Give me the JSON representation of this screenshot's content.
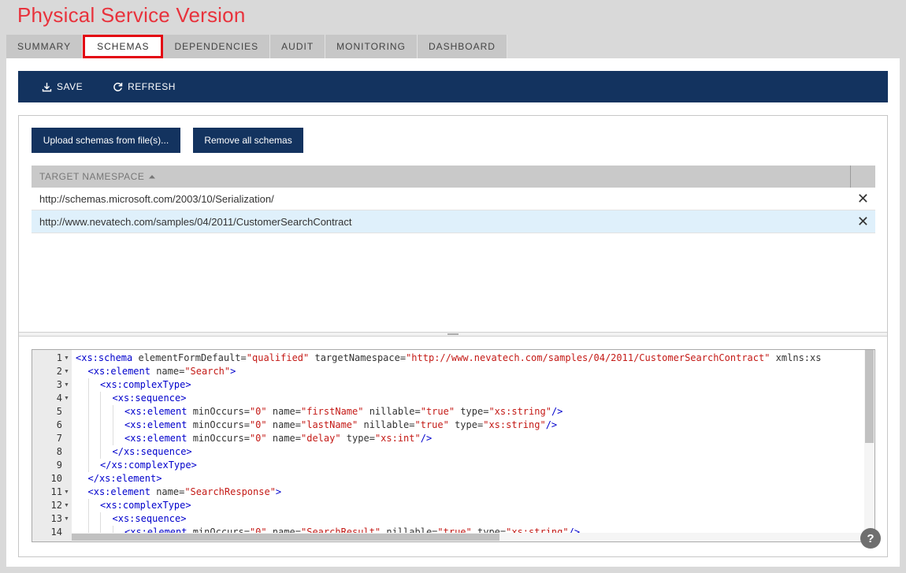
{
  "page": {
    "title": "Physical Service Version"
  },
  "tabs": [
    {
      "label": "SUMMARY",
      "active": false
    },
    {
      "label": "SCHEMAS",
      "active": true
    },
    {
      "label": "DEPENDENCIES",
      "active": false
    },
    {
      "label": "AUDIT",
      "active": false
    },
    {
      "label": "MONITORING",
      "active": false
    },
    {
      "label": "DASHBOARD",
      "active": false
    }
  ],
  "toolbar": {
    "save_label": "SAVE",
    "refresh_label": "REFRESH",
    "save_icon": "download-icon",
    "refresh_icon": "refresh-icon"
  },
  "actions": {
    "upload_label": "Upload schemas from file(s)...",
    "remove_label": "Remove all schemas"
  },
  "grid": {
    "column_header": "TARGET NAMESPACE",
    "sort": "ascending",
    "rows": [
      {
        "namespace": "http://schemas.microsoft.com/2003/10/Serialization/",
        "selected": false
      },
      {
        "namespace": "http://www.nevatech.com/samples/04/2011/CustomerSearchContract",
        "selected": true
      }
    ]
  },
  "editor": {
    "lines": [
      {
        "n": "1",
        "fold": true,
        "indent": 0,
        "parts": [
          [
            "tag",
            "<xs:schema "
          ],
          [
            "attr",
            "elementFormDefault="
          ],
          [
            "val",
            "\"qualified\""
          ],
          [
            "attr",
            " targetNamespace="
          ],
          [
            "val",
            "\"http://www.nevatech.com/samples/04/2011/CustomerSearchContract\""
          ],
          [
            "attr",
            " xmlns:xs"
          ]
        ]
      },
      {
        "n": "2",
        "fold": true,
        "indent": 1,
        "parts": [
          [
            "tag",
            "<xs:element "
          ],
          [
            "attr",
            "name="
          ],
          [
            "val",
            "\"Search\""
          ],
          [
            "tag",
            ">"
          ]
        ]
      },
      {
        "n": "3",
        "fold": true,
        "indent": 2,
        "parts": [
          [
            "tag",
            "<xs:complexType>"
          ]
        ]
      },
      {
        "n": "4",
        "fold": true,
        "indent": 3,
        "parts": [
          [
            "tag",
            "<xs:sequence>"
          ]
        ]
      },
      {
        "n": "5",
        "fold": false,
        "indent": 4,
        "parts": [
          [
            "tag",
            "<xs:element "
          ],
          [
            "attr",
            "minOccurs="
          ],
          [
            "val",
            "\"0\""
          ],
          [
            "attr",
            " name="
          ],
          [
            "val",
            "\"firstName\""
          ],
          [
            "attr",
            " nillable="
          ],
          [
            "val",
            "\"true\""
          ],
          [
            "attr",
            " type="
          ],
          [
            "val",
            "\"xs:string\""
          ],
          [
            "tag",
            "/>"
          ]
        ]
      },
      {
        "n": "6",
        "fold": false,
        "indent": 4,
        "parts": [
          [
            "tag",
            "<xs:element "
          ],
          [
            "attr",
            "minOccurs="
          ],
          [
            "val",
            "\"0\""
          ],
          [
            "attr",
            " name="
          ],
          [
            "val",
            "\"lastName\""
          ],
          [
            "attr",
            " nillable="
          ],
          [
            "val",
            "\"true\""
          ],
          [
            "attr",
            " type="
          ],
          [
            "val",
            "\"xs:string\""
          ],
          [
            "tag",
            "/>"
          ]
        ]
      },
      {
        "n": "7",
        "fold": false,
        "indent": 4,
        "parts": [
          [
            "tag",
            "<xs:element "
          ],
          [
            "attr",
            "minOccurs="
          ],
          [
            "val",
            "\"0\""
          ],
          [
            "attr",
            " name="
          ],
          [
            "val",
            "\"delay\""
          ],
          [
            "attr",
            " type="
          ],
          [
            "val",
            "\"xs:int\""
          ],
          [
            "tag",
            "/>"
          ]
        ]
      },
      {
        "n": "8",
        "fold": false,
        "indent": 3,
        "parts": [
          [
            "tag",
            "</xs:sequence>"
          ]
        ]
      },
      {
        "n": "9",
        "fold": false,
        "indent": 2,
        "parts": [
          [
            "tag",
            "</xs:complexType>"
          ]
        ]
      },
      {
        "n": "10",
        "fold": false,
        "indent": 1,
        "parts": [
          [
            "tag",
            "</xs:element>"
          ]
        ]
      },
      {
        "n": "11",
        "fold": true,
        "indent": 1,
        "parts": [
          [
            "tag",
            "<xs:element "
          ],
          [
            "attr",
            "name="
          ],
          [
            "val",
            "\"SearchResponse\""
          ],
          [
            "tag",
            ">"
          ]
        ]
      },
      {
        "n": "12",
        "fold": true,
        "indent": 2,
        "parts": [
          [
            "tag",
            "<xs:complexType>"
          ]
        ]
      },
      {
        "n": "13",
        "fold": true,
        "indent": 3,
        "parts": [
          [
            "tag",
            "<xs:sequence>"
          ]
        ]
      },
      {
        "n": "14",
        "fold": false,
        "indent": 4,
        "parts": [
          [
            "tag",
            "<xs:element "
          ],
          [
            "attr",
            "minOccurs="
          ],
          [
            "val",
            "\"0\""
          ],
          [
            "attr",
            " name="
          ],
          [
            "val",
            "\"SearchResult\""
          ],
          [
            "attr",
            " nillable="
          ],
          [
            "val",
            "\"true\""
          ],
          [
            "attr",
            " type="
          ],
          [
            "val",
            "\"xs:string\""
          ],
          [
            "tag",
            "/>"
          ]
        ]
      }
    ]
  },
  "help": {
    "label": "?"
  },
  "colors": {
    "title_red": "#e8323c",
    "navy": "#13335f",
    "active_tab_border": "#e30613",
    "selected_row": "#dff0fb"
  }
}
